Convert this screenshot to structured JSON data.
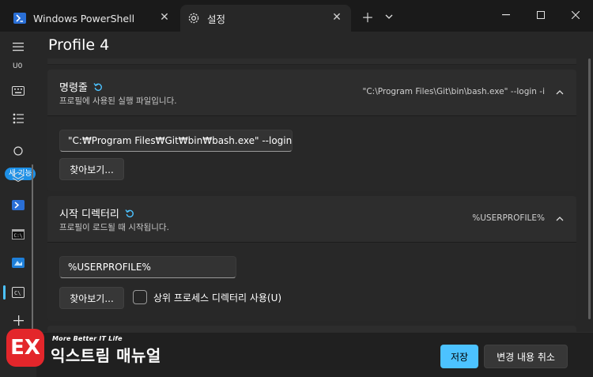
{
  "tabs": [
    {
      "label": "Windows PowerShell",
      "icon": "powershell-icon"
    },
    {
      "label": "설정",
      "icon": "gear-icon",
      "active": true
    }
  ],
  "sidebar": {
    "badge": "새 기능",
    "items": [
      "menu-icon",
      "ubuntu-icon",
      "keyboard-icon",
      "list-icon",
      "whats-new-icon",
      "layers-icon",
      "powershell-icon",
      "cmd-icon",
      "azure-icon",
      "profile-icon",
      "add-icon"
    ]
  },
  "page": {
    "title": "Profile 4"
  },
  "command_line": {
    "title": "명령줄",
    "description": "프로필에 사용된 실행 파일입니다.",
    "value": "\"C:\\Program Files\\Git\\bin\\bash.exe\" --login -i",
    "input_value": "\"C:₩Program Files₩Git₩bin₩bash.exe\" --login -i",
    "browse_label": "찾아보기..."
  },
  "start_dir": {
    "title": "시작 디렉터리",
    "description": "프로필이 로드될 때 시작됩니다.",
    "value": "%USERPROFILE%",
    "input_value": "%USERPROFILE%",
    "browse_label": "찾아보기...",
    "checkbox_label": "상위 프로세스 디렉터리 사용(U)"
  },
  "footer": {
    "save_label": "저장",
    "discard_label": "변경 내용 취소"
  },
  "watermark": {
    "small": "More Better IT Life",
    "big": "익스트림 매뉴얼",
    "logo": "EX"
  },
  "colors": {
    "accent": "#4cc2ff",
    "badge": "#1e90e6",
    "logo": "#e3262b"
  }
}
